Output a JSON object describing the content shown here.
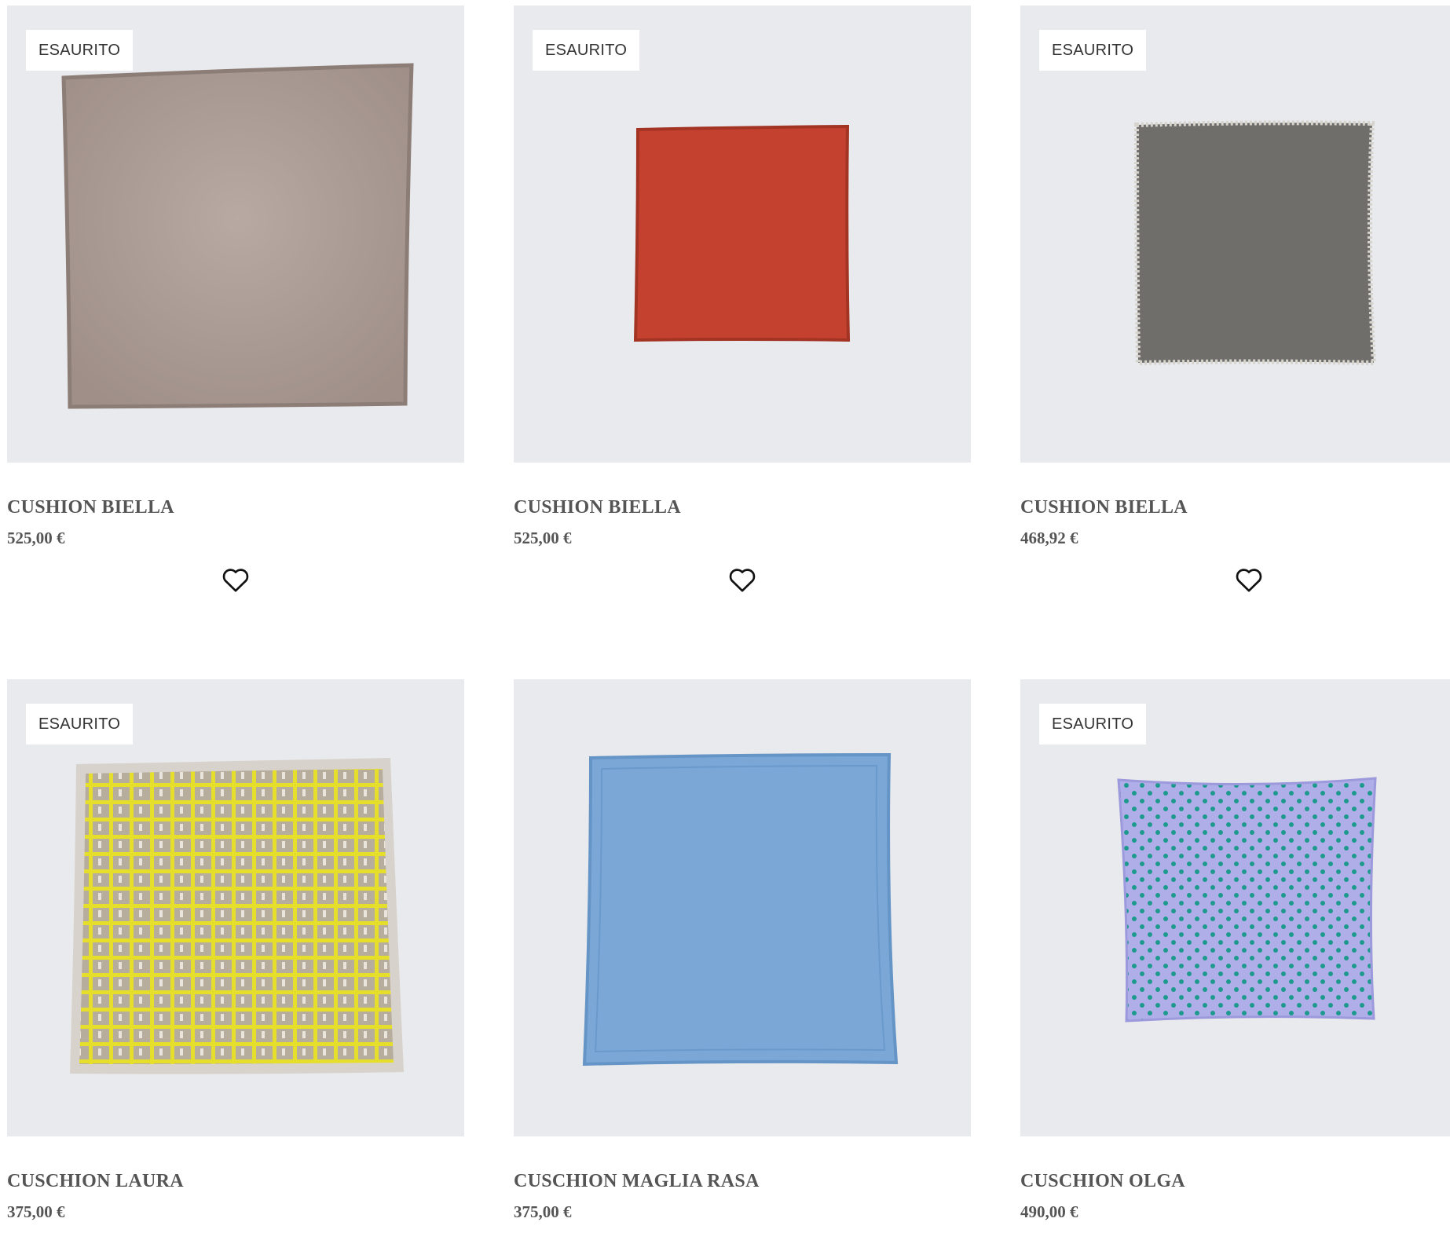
{
  "products": [
    {
      "badge": "ESAURITO",
      "name": "CUSHION BIELLA",
      "price": "525,00 €",
      "image": "taupe cushion",
      "color": "#a5958f",
      "edge": "#8c7d77"
    },
    {
      "badge": "ESAURITO",
      "name": "CUSHION BIELLA",
      "price": "525,00 €",
      "image": "red cushion",
      "color": "#c4412f",
      "edge": "#a33424"
    },
    {
      "badge": "ESAURITO",
      "name": "CUSHION BIELLA",
      "price": "468,92 €",
      "image": "grey cushion",
      "color": "#6f6e6b",
      "edge": "#d6d3cc"
    },
    {
      "badge": "ESAURITO",
      "name": "CUSCHION LAURA",
      "price": "375,00 €",
      "image": "yellow check cushion",
      "color": "#b7ad9c",
      "edge": "#d8d2cc",
      "accent": "#e5de2b"
    },
    {
      "badge": "",
      "name": "CUSCHION MAGLIA RASA",
      "price": "375,00 €",
      "image": "light blue cushion",
      "color": "#7aa7d6",
      "edge": "#6594c6"
    },
    {
      "badge": "ESAURITO",
      "name": "CUSCHION OLGA",
      "price": "490,00 €",
      "image": "lavender polka dot cushion",
      "color": "#b0aee8",
      "edge": "#9c99dd",
      "accent": "#1d9a8e"
    }
  ],
  "icons": {
    "wishlist": "heart-outline-icon"
  }
}
